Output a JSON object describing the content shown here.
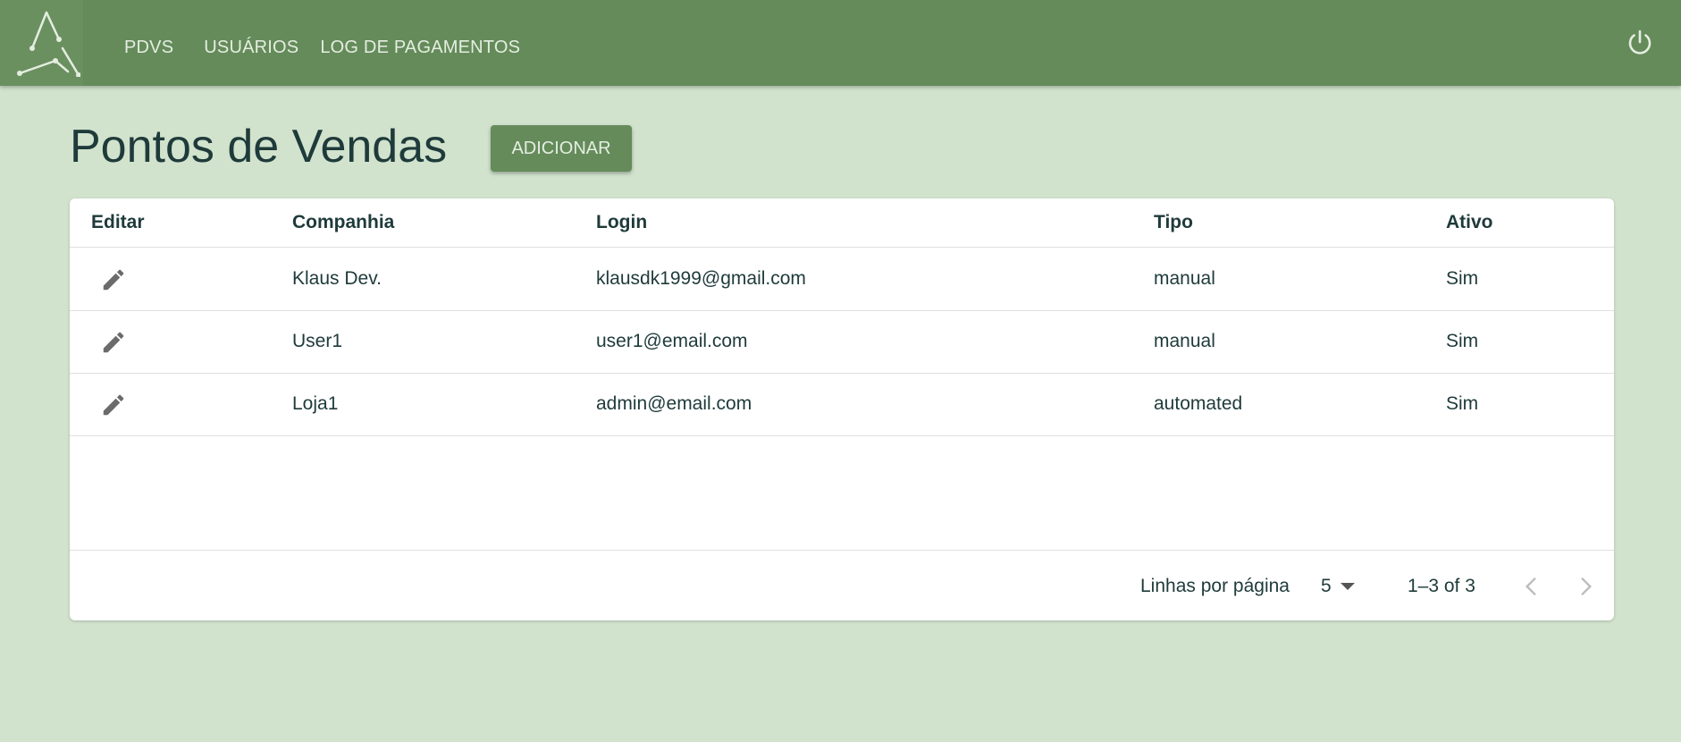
{
  "nav": {
    "items": [
      {
        "label": "PDVS"
      },
      {
        "label": "USUÁRIOS"
      },
      {
        "label": "LOG DE PAGAMENTOS"
      }
    ]
  },
  "page": {
    "title": "Pontos de Vendas",
    "add_label": "ADICIONAR"
  },
  "table": {
    "columns": [
      "Editar",
      "Companhia",
      "Login",
      "Tipo",
      "Ativo"
    ],
    "rows": [
      {
        "companhia": "Klaus Dev.",
        "login": "klausdk1999@gmail.com",
        "tipo": "manual",
        "ativo": "Sim"
      },
      {
        "companhia": "User1",
        "login": "user1@email.com",
        "tipo": "manual",
        "ativo": "Sim"
      },
      {
        "companhia": "Loja1",
        "login": "admin@email.com",
        "tipo": "automated",
        "ativo": "Sim"
      }
    ]
  },
  "pagination": {
    "rows_per_page_label": "Linhas por página",
    "rows_per_page": "5",
    "range": "1–3 of 3"
  },
  "icons": {
    "logo": "logo-icon",
    "power": "power-icon",
    "edit": "pencil-icon",
    "prev": "chevron-left-icon",
    "next": "chevron-right-icon"
  },
  "colors": {
    "appbar": "#658b5b",
    "background": "#d1e3cd",
    "text": "#1f3a3a"
  }
}
